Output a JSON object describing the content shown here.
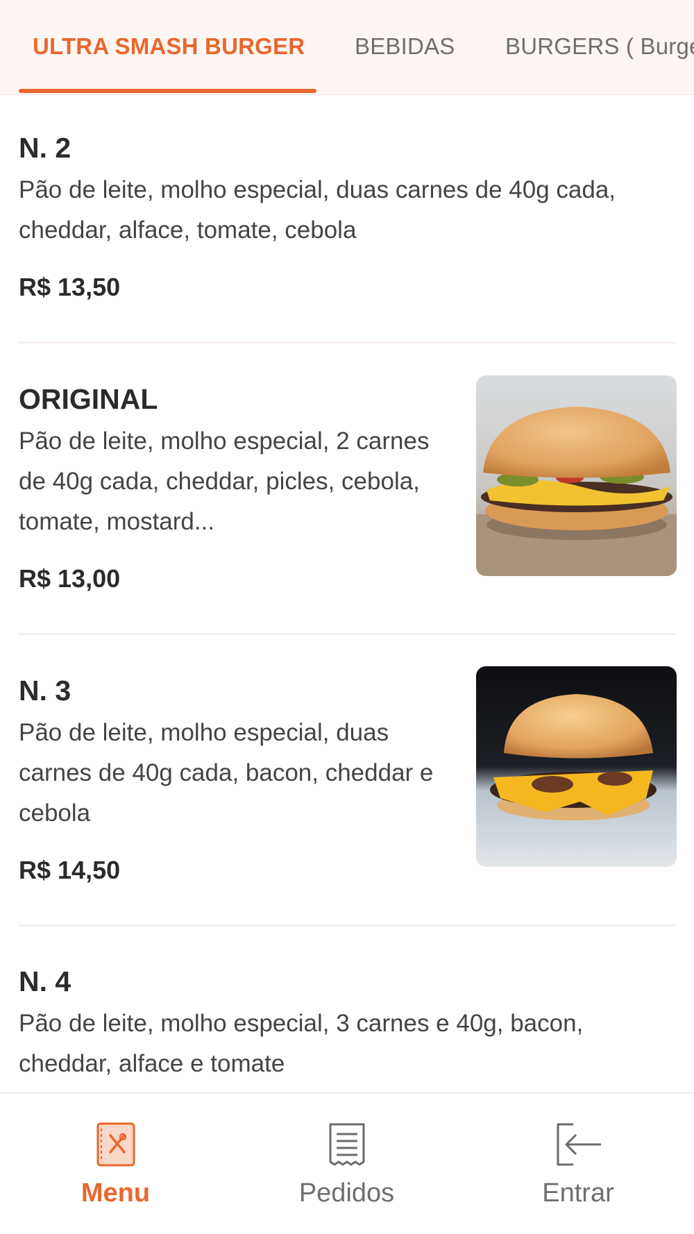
{
  "tabs": [
    {
      "label": "ULTRA SMASH BURGER",
      "active": true
    },
    {
      "label": "BEBIDAS",
      "active": false
    },
    {
      "label": "BURGERS ( Burgers",
      "active": false
    }
  ],
  "items": [
    {
      "name": "N. 2",
      "description": "Pão de leite, molho especial, duas carnes de 40g cada, cheddar, alface, tomate, cebola",
      "price": "R$ 13,50",
      "has_photo": false
    },
    {
      "name": "ORIGINAL",
      "description": "Pão de leite, molho especial, 2 carnes de 40g cada, cheddar, picles, cebola, tomate, mostard...",
      "price": "R$ 13,00",
      "has_photo": true,
      "photo_icon": "burger-photo-icon"
    },
    {
      "name": "N. 3",
      "description": "Pão de leite, molho especial, duas carnes de 40g cada, bacon, cheddar e cebola",
      "price": "R$ 14,50",
      "has_photo": true,
      "photo_icon": "burger-photo-icon"
    },
    {
      "name": "N. 4",
      "description": "Pão de leite, molho especial, 3 carnes e 40g, bacon, cheddar, alface e tomate",
      "price": "",
      "has_photo": false
    }
  ],
  "bottom_nav": [
    {
      "label": "Menu",
      "icon": "menu-book-icon",
      "active": true
    },
    {
      "label": "Pedidos",
      "icon": "receipt-icon",
      "active": false
    },
    {
      "label": "Entrar",
      "icon": "login-icon",
      "active": false
    }
  ],
  "colors": {
    "accent": "#e8672f",
    "text": "#2b2b2b",
    "muted": "#6f6f6f",
    "tab_background": "#fdf6f3"
  }
}
